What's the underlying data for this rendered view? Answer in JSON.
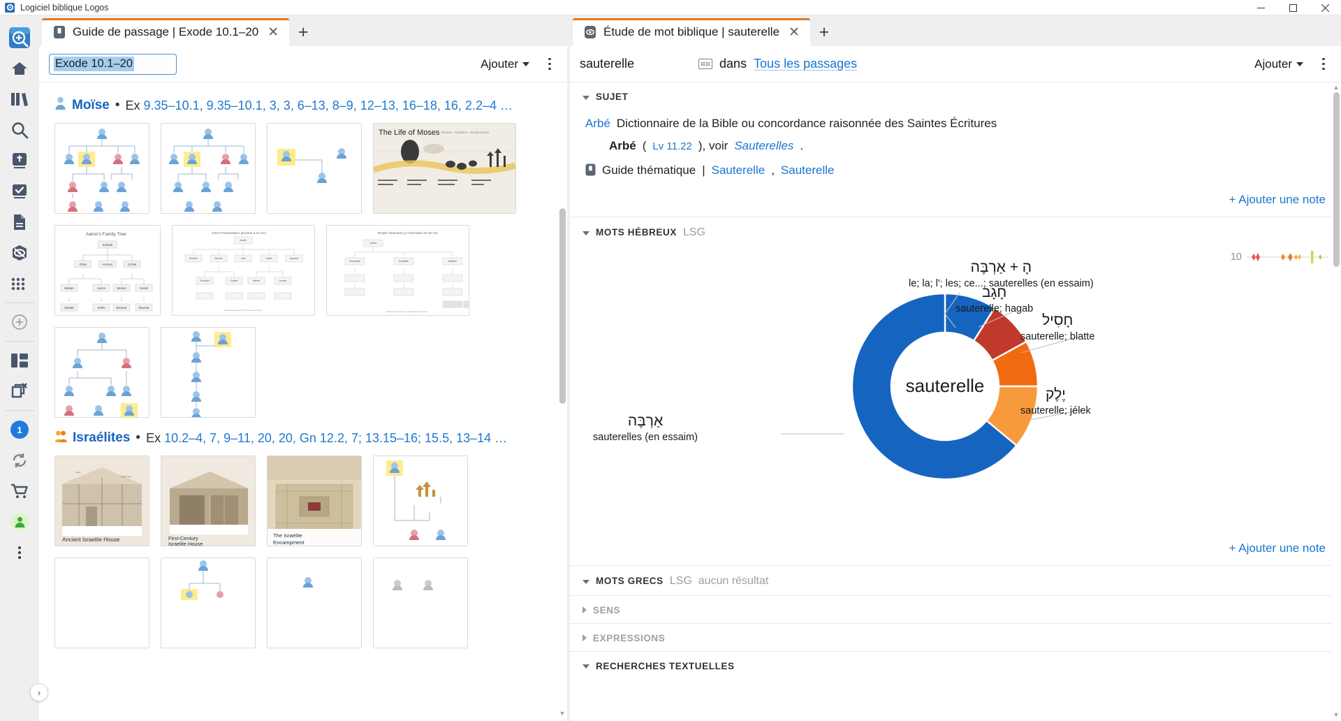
{
  "window": {
    "app_title": "Logiciel biblique Logos",
    "minimize": "–",
    "maximize": "▢",
    "close": "✕"
  },
  "left_panel": {
    "tab": {
      "label": "Guide de passage | Exode 10.1–20",
      "close": "✕",
      "icon": "book-icon"
    },
    "new_tab": "+",
    "toolbar": {
      "reference_value": "Exode 10.1–20",
      "reference_placeholder": "Exode 10.1–20",
      "add_label": "Ajouter",
      "menu_icon": "kebab-menu-icon"
    },
    "sections": [
      {
        "name": "Moïse",
        "icon": "person-blue-icon",
        "separator": "•",
        "refs_prefix": "Ex ",
        "refs": "9.35–10.1, 9.35–10.1, 3, 3, 6–13, 8–9, 12–13, 16–18, 16, 2.2–4 …",
        "thumb_rows": [
          [
            {
              "name": "family-tree-diagram-1",
              "caption": ""
            },
            {
              "name": "family-tree-diagram-2",
              "caption": ""
            },
            {
              "name": "relationship-diagram-3",
              "caption": ""
            },
            {
              "name": "life-of-moses-infographic",
              "caption": "The Life of Moses"
            }
          ],
          [
            {
              "name": "aarons-family-tree",
              "caption": "Aaron's Family Tree"
            },
            {
              "name": "john-testament-exodus-chart",
              "caption": ""
            },
            {
              "name": "temple-treasures-chart",
              "caption": "Temple Treasures (1 Chronicles 26.20–32)"
            }
          ],
          [
            {
              "name": "family-tree-diagram-4",
              "caption": ""
            },
            {
              "name": "lineage-chain-diagram",
              "caption": ""
            }
          ]
        ]
      },
      {
        "name": "Israélites",
        "icon": "people-orange-icon",
        "separator": "•",
        "refs_prefix": "Ex ",
        "refs": "10.2–4, 7, 9–11, 20, 20, Gn 12.2, 7; 13.15–16; 15.5, 13–14 …",
        "thumb_rows": [
          [
            {
              "name": "ancient-israelite-house",
              "caption": "Ancient Israelite House"
            },
            {
              "name": "first-century-israelite-house",
              "caption": "First-Century Israelite House"
            },
            {
              "name": "the-israelite-encampment",
              "caption": "The Israelite Encampment"
            },
            {
              "name": "israelite-lineage-diagram",
              "caption": ""
            }
          ],
          [
            {
              "name": "partial-diagram-a",
              "caption": ""
            },
            {
              "name": "partial-diagram-b",
              "caption": ""
            },
            {
              "name": "partial-diagram-c",
              "caption": ""
            },
            {
              "name": "partial-diagram-d",
              "caption": ""
            }
          ]
        ]
      }
    ]
  },
  "right_panel": {
    "tab": {
      "label": "Étude de mot biblique | sauterelle",
      "close": "✕",
      "icon": "word-study-icon"
    },
    "new_tab": "+",
    "search": {
      "term": "sauterelle",
      "placeholder": "sauterelle",
      "keyboard_icon": "keyboard-icon",
      "in_label": "dans",
      "scope": "Tous les passages",
      "add_label": "Ajouter",
      "menu_icon": "kebab-menu-icon"
    },
    "sections": {
      "sujet": {
        "title": "SUJET",
        "expanded": true,
        "entry_word": "Arbé",
        "entry_source": "Dictionnaire de la Bible ou concordance raisonnée des Saintes Écritures",
        "sub_word": "Arbé",
        "sub_open": " (",
        "sub_ref": "Lv 11.22",
        "sub_mid": "), voir ",
        "sub_see": "Sauterelles",
        "sub_end": ".",
        "topic_guide_label": "Guide thématique",
        "topic_guide_sep": " | ",
        "topic_links": [
          "Sauterelle",
          "Sauterelle"
        ],
        "add_note": "+ Ajouter une note"
      },
      "mots_hebreux": {
        "title": "MOTS HÉBREUX",
        "badge": "LSG",
        "expanded": true,
        "add_note": "+ Ajouter une note",
        "sparkline_label": "10"
      },
      "mots_grecs": {
        "title": "MOTS GRECS",
        "badge": "LSG",
        "note": "aucun résultat",
        "expanded": true
      },
      "sens": {
        "title": "SENS",
        "expanded": false
      },
      "expressions": {
        "title": "EXPRESSIONS",
        "expanded": false
      },
      "recherches": {
        "title": "RECHERCHES TEXTUELLES",
        "expanded": true
      }
    }
  },
  "chart_data": {
    "type": "pie",
    "title": "sauterelle",
    "center_label": "sauterelle",
    "subtitle": "MOTS HÉBREUX — LSG",
    "legend_position": "callouts",
    "categories": [
      "הָ + אַרְבֶּה",
      "חָגָב",
      "חָסִיל",
      "יֶלֶק",
      "אַרְבֶּה"
    ],
    "gloss": [
      "le; la; l'; les; ce...; sauterelles (en essaim)",
      "sauterelle; hagab",
      "sauterelle; blatte",
      "sauterelle; jélek",
      "sauterelles (en essaim)"
    ],
    "values": [
      9,
      8,
      8,
      11,
      64
    ],
    "colors": [
      "#1565c0",
      "#c0392b",
      "#f26a0f",
      "#f79a3c",
      "#1565c0"
    ],
    "hole": 0.58,
    "total": 100
  },
  "icons": {
    "logos_app": "logos-app-icon",
    "home": "home-icon",
    "library": "library-icon",
    "search": "search-icon",
    "bible": "bible-plus-icon",
    "tasks": "checkbook-icon",
    "documents": "document-icon",
    "guides": "guides-icon",
    "tools": "grid-apps-icon",
    "add": "circle-plus-icon",
    "layouts": "layouts-icon",
    "close_layout": "close-layout-icon",
    "notifications_count": "1",
    "sync": "sync-icon",
    "store": "cart-icon",
    "account": "account-icon",
    "more": "more-vertical-icon",
    "expander": "›"
  }
}
